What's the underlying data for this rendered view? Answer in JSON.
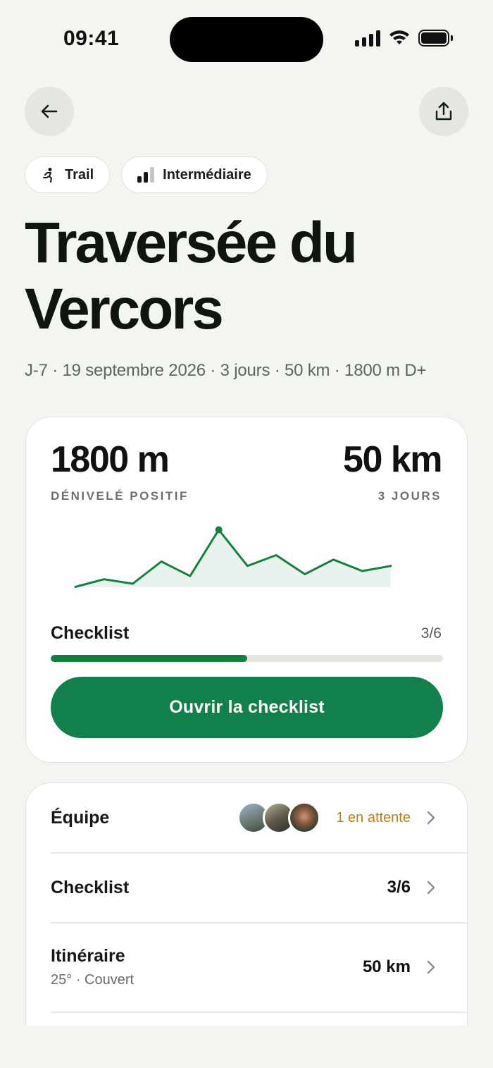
{
  "status": {
    "time": "09:41"
  },
  "chips": {
    "sport": "Trail",
    "level": "Intermédiaire"
  },
  "trip": {
    "title": "Traversée du Vercors",
    "meta": "J-7 · 19 septembre 2026 · 3 jours · 50 km · 1800 m D+"
  },
  "stats": {
    "elevation_value": "1800 m",
    "elevation_label": "DÉNIVELÉ POSITIF",
    "distance_value": "50 km",
    "distance_label": "3 JOURS"
  },
  "profile_chart": {
    "type": "area",
    "values": [
      0.05,
      0.17,
      0.1,
      0.45,
      0.22,
      0.95,
      0.38,
      0.55,
      0.25,
      0.48,
      0.3,
      0.38
    ],
    "peak_index": 5,
    "color": "#16803f"
  },
  "checklist": {
    "label": "Checklist",
    "count": "3/6",
    "progress": 0.5,
    "cta": "Ouvrir la checklist"
  },
  "list": {
    "team_label": "Équipe",
    "team_status": "1 en attente",
    "checklist_label": "Checklist",
    "checklist_value": "3/6",
    "route_label": "Itinéraire",
    "route_sub": "25° · Couvert",
    "route_value": "50 km"
  },
  "colors": {
    "accent": "#12804a",
    "pending": "#b9800f",
    "background": "#f3f5f0"
  }
}
